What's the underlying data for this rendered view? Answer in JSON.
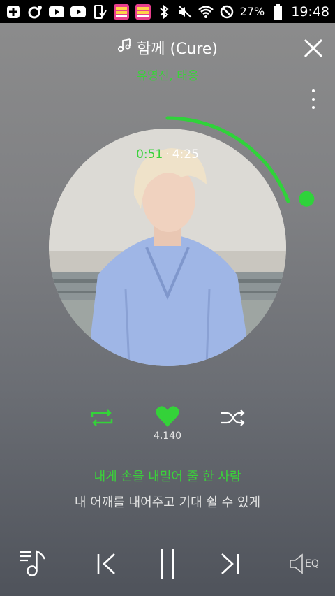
{
  "status_bar": {
    "battery_percent": "27%",
    "time": "19:48",
    "icons": [
      "add-icon",
      "circle-icon",
      "youtube-icon",
      "youtube-icon",
      "download-icon",
      "superstar-app-icon",
      "superstar-app-icon",
      "bluetooth-icon",
      "mute-icon",
      "wifi-icon",
      "blocked-icon",
      "battery-icon"
    ]
  },
  "player": {
    "title": "함께 (Cure)",
    "artist": "유영진, 태용",
    "elapsed": "0:51",
    "separator": "·",
    "duration": "4:25",
    "progress_fraction": 0.192,
    "like_count": "4,140"
  },
  "lyrics": {
    "current": "내게 손을 내밀어 줄 한 사람",
    "next": "내 어깨를 내어주고 기대 쉴 수 있게"
  },
  "bottom": {
    "eq_label": "EQ"
  },
  "colors": {
    "accent": "#3ad23a",
    "text": "#ffffff"
  }
}
